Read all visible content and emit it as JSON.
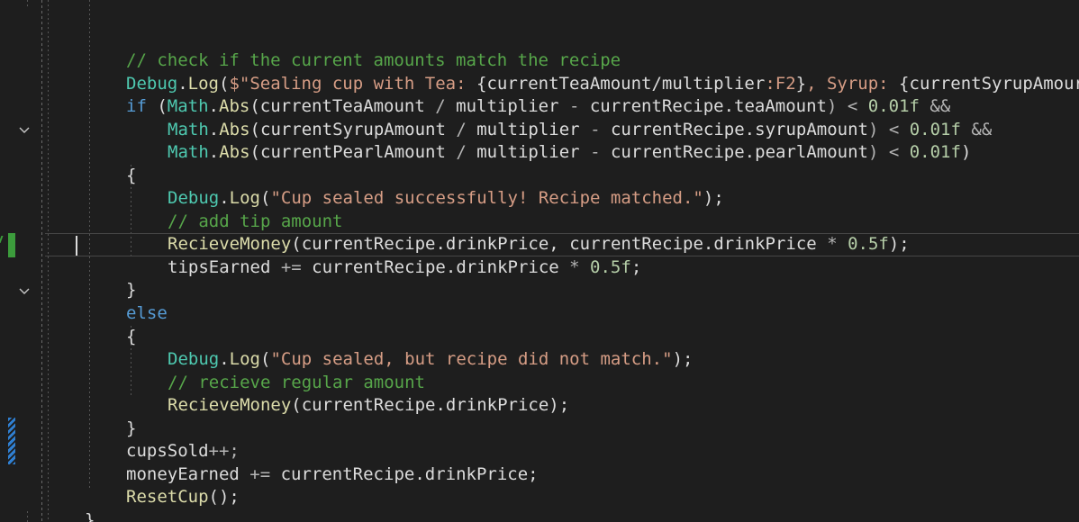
{
  "editor": {
    "lines": {
      "l1": {
        "t1": "// check if the current amounts match the recipe"
      },
      "l2": {
        "t1": "Debug",
        "t2": ".",
        "t3": "Log",
        "t4": "(",
        "t5": "$\"Sealing cup with Tea: ",
        "t6": "{",
        "t7": "currentTeaAmount",
        "t8": "/",
        "t9": "multiplier",
        "t10": ":F2",
        "t11": "}",
        "t12": ", Syrup: ",
        "t13": "{",
        "t14": "currentSyrupAmour"
      },
      "l3": {
        "t1": "if",
        "t2": " (",
        "t3": "Math",
        "t4": ".",
        "t5": "Abs",
        "t6": "(",
        "t7": "currentTeaAmount",
        "t8": " / ",
        "t9": "multiplier",
        "t10": " - ",
        "t11": "currentRecipe",
        "t12": ".",
        "t13": "teaAmount",
        "t14": ") < ",
        "t15": "0.01f",
        "t16": " &&"
      },
      "l4": {
        "t1": "Math",
        "t2": ".",
        "t3": "Abs",
        "t4": "(",
        "t5": "currentSyrupAmount",
        "t6": " / ",
        "t7": "multiplier",
        "t8": " - ",
        "t9": "currentRecipe",
        "t10": ".",
        "t11": "syrupAmount",
        "t12": ") < ",
        "t13": "0.01f",
        "t14": " &&"
      },
      "l5": {
        "t1": "Math",
        "t2": ".",
        "t3": "Abs",
        "t4": "(",
        "t5": "currentPearlAmount",
        "t6": " / ",
        "t7": "multiplier",
        "t8": " - ",
        "t9": "currentRecipe",
        "t10": ".",
        "t11": "pearlAmount",
        "t12": ") < ",
        "t13": "0.01f",
        "t14": ")"
      },
      "l6": {
        "t1": "{"
      },
      "l7": {
        "t1": "Debug",
        "t2": ".",
        "t3": "Log",
        "t4": "(",
        "t5": "\"Cup sealed successfully! Recipe matched.\"",
        "t6": ");"
      },
      "l8": {
        "t1": "// add tip amount"
      },
      "l9": {
        "t1": "RecieveMoney",
        "t2": "(",
        "t3": "currentRecipe",
        "t4": ".",
        "t5": "drinkPrice",
        "t6": ", ",
        "t7": "currentRecipe",
        "t8": ".",
        "t9": "drinkPrice",
        "t10": " * ",
        "t11": "0.5f",
        "t12": ");"
      },
      "l10": {
        "t1": "tipsEarned",
        "t2": " += ",
        "t3": "currentRecipe",
        "t4": ".",
        "t5": "drinkPrice",
        "t6": " * ",
        "t7": "0.5f",
        "t8": ";"
      },
      "l11": {
        "t1": "}"
      },
      "l12": {
        "t1": "else"
      },
      "l13": {
        "t1": "{"
      },
      "l14": {
        "t1": "Debug",
        "t2": ".",
        "t3": "Log",
        "t4": "(",
        "t5": "\"Cup sealed, but recipe did not match.\"",
        "t6": ");"
      },
      "l15": {
        "t1": "// recieve regular amount"
      },
      "l16": {
        "t1": "RecieveMoney",
        "t2": "(",
        "t3": "currentRecipe",
        "t4": ".",
        "t5": "drinkPrice",
        "t6": ");"
      },
      "l17": {
        "t1": "}"
      },
      "l18": {
        "t1": "cupsSold",
        "t2": "++;"
      },
      "l19": {
        "t1": "moneyEarned",
        "t2": " += ",
        "t3": "currentRecipe",
        "t4": ".",
        "t5": "drinkPrice",
        "t6": ";"
      },
      "l20": {
        "t1": "ResetCup",
        "t2": "();"
      },
      "l21": {
        "t1": "}"
      }
    }
  },
  "theme": {
    "background": "#1e1e1e",
    "keyword": "#569cd6",
    "comment": "#57a64a",
    "type": "#4ec9b0",
    "method": "#dcdcaa",
    "string": "#d69d85",
    "number": "#b5cea8",
    "identifier": "#dcdcdc",
    "added_line_marker": "#3c9c3c",
    "modified_line_marker": "#2f7fd1"
  },
  "gutter": {
    "fold_icons": [
      "chevron-down-icon",
      "chevron-down-icon"
    ]
  }
}
